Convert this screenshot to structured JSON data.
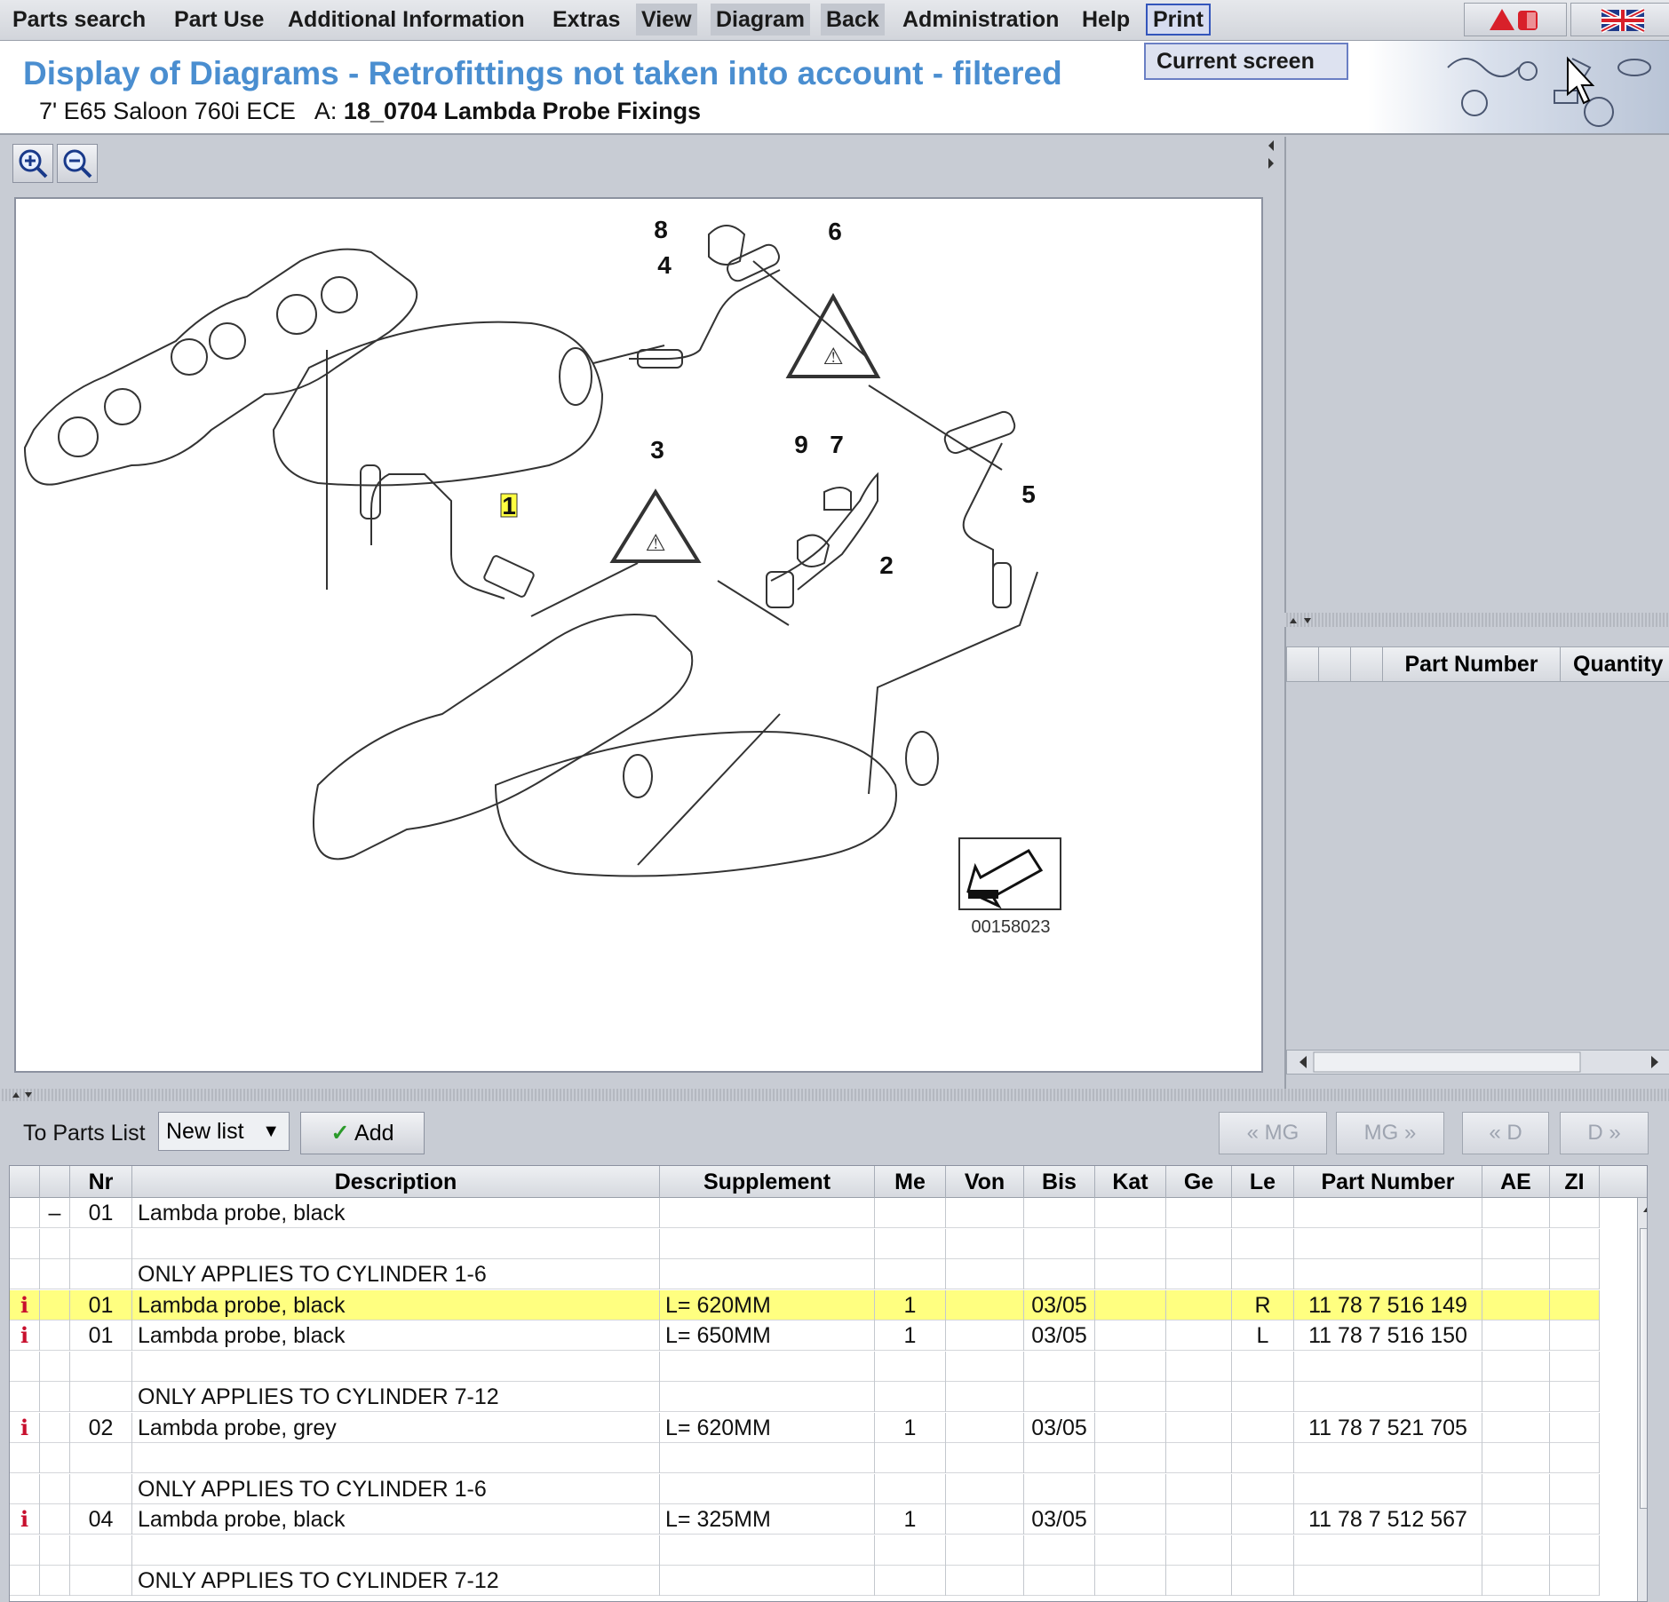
{
  "menu": {
    "items": [
      "Parts search",
      "Part Use",
      "Additional Information",
      "Extras",
      "View",
      "Diagram",
      "Back",
      "Administration",
      "Help",
      "Print"
    ],
    "print_dropdown": "Current screen"
  },
  "header": {
    "title": "Display of Diagrams - Retrofittings not taken into account - filtered",
    "vehicle": "7' E65 Saloon 760i ECE",
    "a_label": "A:",
    "group": "18_0704 Lambda Probe Fixings"
  },
  "diagram": {
    "image_number": "00158023",
    "callouts": [
      "1",
      "2",
      "3",
      "4",
      "5",
      "6",
      "7",
      "8",
      "9"
    ]
  },
  "right_panel": {
    "columns": [
      "Part Number",
      "Quantity"
    ]
  },
  "toolbar": {
    "to_parts_list": "To Parts List",
    "list_select": "New list",
    "add_label": "Add",
    "nav": [
      "« MG",
      "MG »",
      "« D",
      "D »"
    ]
  },
  "table": {
    "columns": [
      "Nr",
      "Description",
      "Supplement",
      "Me",
      "Von",
      "Bis",
      "Kat",
      "Ge",
      "Le",
      "Part Number",
      "AE",
      "ZI"
    ],
    "rows": [
      {
        "info": "",
        "sign": "–",
        "nr": "01",
        "desc": "Lambda probe, black",
        "supp": "",
        "me": "",
        "bis": "",
        "le": "",
        "pn": "",
        "highlight": false
      },
      {
        "info": "",
        "sign": "",
        "nr": "",
        "desc": "",
        "supp": "",
        "me": "",
        "bis": "",
        "le": "",
        "pn": "",
        "highlight": false
      },
      {
        "info": "",
        "sign": "",
        "nr": "",
        "desc": "ONLY APPLIES TO CYLINDER 1-6",
        "supp": "",
        "me": "",
        "bis": "",
        "le": "",
        "pn": "",
        "highlight": false
      },
      {
        "info": "i",
        "sign": "",
        "nr": "01",
        "desc": "Lambda probe, black",
        "supp": "L= 620MM",
        "me": "1",
        "bis": "03/05",
        "le": "R",
        "pn": "11 78 7 516 149",
        "highlight": true
      },
      {
        "info": "i",
        "sign": "",
        "nr": "01",
        "desc": "Lambda probe, black",
        "supp": "L= 650MM",
        "me": "1",
        "bis": "03/05",
        "le": "L",
        "pn": "11 78 7 516 150",
        "highlight": false
      },
      {
        "info": "",
        "sign": "",
        "nr": "",
        "desc": "",
        "supp": "",
        "me": "",
        "bis": "",
        "le": "",
        "pn": "",
        "highlight": false
      },
      {
        "info": "",
        "sign": "",
        "nr": "",
        "desc": "ONLY APPLIES TO CYLINDER 7-12",
        "supp": "",
        "me": "",
        "bis": "",
        "le": "",
        "pn": "",
        "highlight": false
      },
      {
        "info": "i",
        "sign": "",
        "nr": "02",
        "desc": "Lambda probe, grey",
        "supp": "L= 620MM",
        "me": "1",
        "bis": "03/05",
        "le": "",
        "pn": "11 78 7 521 705",
        "highlight": false
      },
      {
        "info": "",
        "sign": "",
        "nr": "",
        "desc": "",
        "supp": "",
        "me": "",
        "bis": "",
        "le": "",
        "pn": "",
        "highlight": false
      },
      {
        "info": "",
        "sign": "",
        "nr": "",
        "desc": "ONLY APPLIES TO CYLINDER 1-6",
        "supp": "",
        "me": "",
        "bis": "",
        "le": "",
        "pn": "",
        "highlight": false
      },
      {
        "info": "i",
        "sign": "",
        "nr": "04",
        "desc": "Lambda probe, black",
        "supp": "L= 325MM",
        "me": "1",
        "bis": "03/05",
        "le": "",
        "pn": "11 78 7 512 567",
        "highlight": false
      },
      {
        "info": "",
        "sign": "",
        "nr": "",
        "desc": "",
        "supp": "",
        "me": "",
        "bis": "",
        "le": "",
        "pn": "",
        "highlight": false
      },
      {
        "info": "",
        "sign": "",
        "nr": "",
        "desc": "ONLY APPLIES TO CYLINDER 7-12",
        "supp": "",
        "me": "",
        "bis": "",
        "le": "",
        "pn": "",
        "highlight": false
      }
    ]
  },
  "colors": {
    "title": "#4a8ed0",
    "highlight_row": "#ffff80",
    "info_icon": "#c8102e"
  }
}
